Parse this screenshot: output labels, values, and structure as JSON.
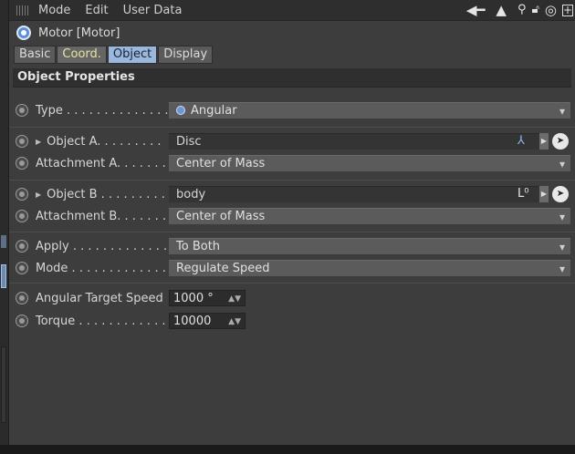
{
  "menu": {
    "items": [
      "Mode",
      "Edit",
      "User Data"
    ]
  },
  "title": "Motor [Motor]",
  "tabs": [
    "Basic",
    "Coord.",
    "Object",
    "Display"
  ],
  "active_tab": "Object",
  "section": "Object Properties",
  "props": {
    "type": {
      "label": "Type . . . . . . . . . . . . . .",
      "value": "Angular"
    },
    "object_a": {
      "label": "Object A. . . . . . . . .",
      "value": "Disc"
    },
    "attachment_a": {
      "label": "Attachment A. . . . . . .",
      "value": "Center of Mass"
    },
    "object_b": {
      "label": "Object B . . . . . . . . .",
      "value": "body"
    },
    "attachment_b": {
      "label": "Attachment B. . . . . . .",
      "value": "Center of Mass"
    },
    "apply": {
      "label": "Apply . . . . . . . . . . . . .",
      "value": "To Both"
    },
    "mode": {
      "label": "Mode . . . . . . . . . . . . .",
      "value": "Regulate Speed"
    },
    "angular_target_speed": {
      "label": "Angular Target Speed",
      "value": "1000 °"
    },
    "torque": {
      "label": "Torque . . . . . . . . . . . .",
      "value": "10000"
    }
  },
  "colors": {
    "active_tab": "#9ab8de",
    "coord_tab_text": "#e8e3a0",
    "motor_icon": "#5c8fd6"
  }
}
